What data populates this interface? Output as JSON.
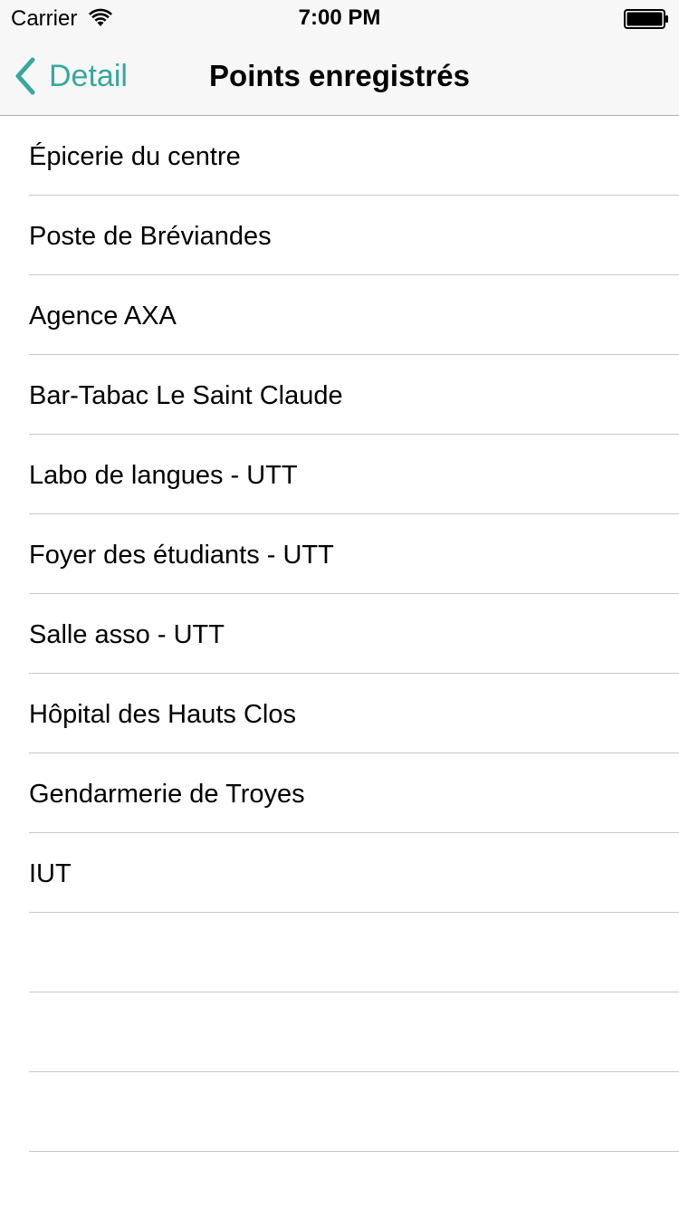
{
  "status_bar": {
    "carrier": "Carrier",
    "time": "7:00 PM",
    "wifi_icon": "wifi-icon",
    "battery_icon": "battery-full-icon"
  },
  "nav_bar": {
    "back_label": "Detail",
    "back_icon": "chevron-left-icon",
    "title": "Points enregistrés",
    "accent_color": "#38a89d"
  },
  "list": {
    "items": [
      {
        "label": "Épicerie du centre"
      },
      {
        "label": "Poste de Bréviandes"
      },
      {
        "label": "Agence AXA"
      },
      {
        "label": "Bar-Tabac Le Saint Claude"
      },
      {
        "label": "Labo de langues - UTT"
      },
      {
        "label": "Foyer des étudiants - UTT"
      },
      {
        "label": "Salle asso - UTT"
      },
      {
        "label": "Hôpital des Hauts Clos"
      },
      {
        "label": "Gendarmerie de Troyes"
      },
      {
        "label": "IUT"
      }
    ],
    "empty_rows": 3
  }
}
